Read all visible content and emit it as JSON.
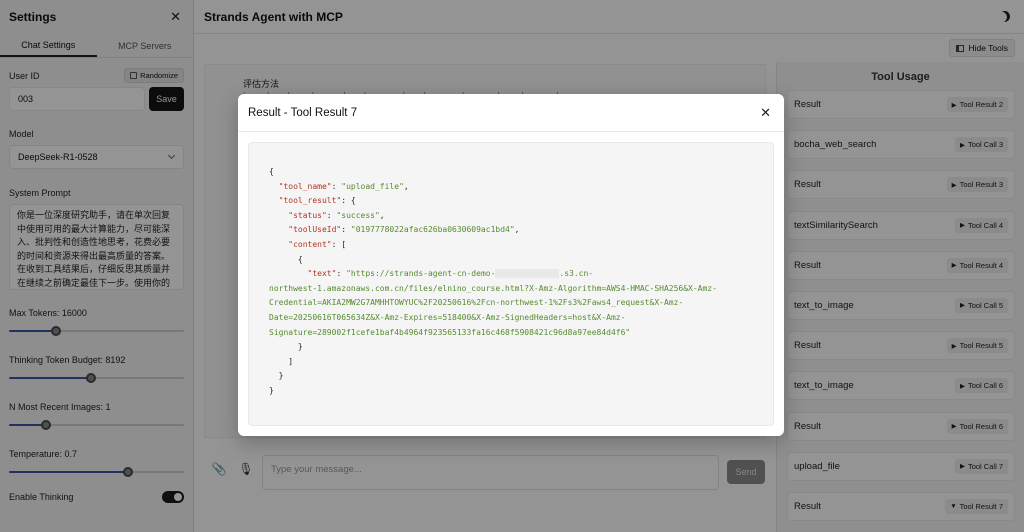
{
  "sidebar": {
    "title": "Settings",
    "close_icon": "close-icon",
    "tabs": [
      {
        "label": "Chat Settings",
        "active": true
      },
      {
        "label": "MCP Servers",
        "active": false
      }
    ],
    "user_id": {
      "label": "User ID",
      "randomize_label": "Randomize",
      "value": "003",
      "save_label": "Save"
    },
    "model": {
      "label": "Model",
      "value": "DeepSeek-R1-0528"
    },
    "system_prompt": {
      "label": "System Prompt",
      "value": "你是一位深度研究助手，请在单次回复中使用可用的最大计算能力，尽可能深入、批判性和创造性地思考，花费必要的时间和资源来得出最高质量的答案。\n在收到工具结果后，仔细反思其质量并在继续之前确定最佳下一步。使用你的思考基于这些新信息进行规划和迭代，然后采"
    },
    "max_tokens": {
      "label": "Max Tokens: 16000",
      "fraction": 0.27
    },
    "thinking_budget": {
      "label": "Thinking Token Budget: 8192",
      "fraction": 0.47
    },
    "n_images": {
      "label": "N Most Recent Images: 1",
      "fraction": 0.21
    },
    "temperature": {
      "label": "Temperature: 0.7",
      "fraction": 0.68
    },
    "enable_thinking": {
      "label": "Enable Thinking",
      "on": true
    }
  },
  "main": {
    "title": "Strands Agent with MCP",
    "theme_icon": "moon-icon",
    "hide_tools_label": "Hide Tools",
    "chat": {
      "heading": "评估方法",
      "partial_line": "| ···· | ··· | ···· | ······ | ··· | ········ | ··· | ········ | ······· | ···· | ······· |"
    },
    "input_placeholder": "Type your message...",
    "send_label": "Send"
  },
  "tool_panel": {
    "title": "Tool Usage",
    "items": [
      {
        "name": "Result",
        "chip": "Tool Result 2",
        "expanded": false
      },
      {
        "name": "bocha_web_search",
        "chip": "Tool Call 3",
        "expanded": false
      },
      {
        "name": "Result",
        "chip": "Tool Result 3",
        "expanded": false
      },
      {
        "name": "textSimilaritySearch",
        "chip": "Tool Call 4",
        "expanded": false
      },
      {
        "name": "Result",
        "chip": "Tool Result 4",
        "expanded": false
      },
      {
        "name": "text_to_image",
        "chip": "Tool Call 5",
        "expanded": false
      },
      {
        "name": "Result",
        "chip": "Tool Result 5",
        "expanded": false
      },
      {
        "name": "text_to_image",
        "chip": "Tool Call 6",
        "expanded": false
      },
      {
        "name": "Result",
        "chip": "Tool Result 6",
        "expanded": false
      },
      {
        "name": "upload_file",
        "chip": "Tool Call 7",
        "expanded": false
      },
      {
        "name": "Result",
        "chip": "Tool Result 7",
        "expanded": true
      }
    ]
  },
  "modal": {
    "title": "Result - Tool Result 7",
    "code": {
      "open": "{",
      "tool_name_key": "\"tool_name\"",
      "tool_name_value": "\"upload_file\"",
      "tool_result_key": "\"tool_result\"",
      "status_key": "\"status\"",
      "status_value": "\"success\"",
      "tool_use_id_key": "\"toolUseId\"",
      "tool_use_id_value": "\"0197778022afac626ba0630609ac1bd4\"",
      "content_key": "\"content\"",
      "text_key": "\"text\"",
      "text_value_start": "\"https://strands-agent-cn-demo-",
      "text_value_line1_end": ".s3.cn-",
      "text_value_line2": "northwest-1.amazonaws.com.cn/files/elnino_course.html?X-Amz-Algorithm=AWS4-HMAC-SHA256&X-Amz-",
      "text_value_line3": "Credential=AKIA2MW2G7AMHHTOWYUC%2F20250616%2Fcn-northwest-1%2Fs3%2Faws4_request&X-Amz-",
      "text_value_line4": "Date=20250616T065634Z&X-Amz-Expires=518400&X-Amz-SignedHeaders=host&X-Amz-",
      "text_value_line5": "Signature=289002f1cefe1baf4b4964f923565133fa16c468f5908421c96d8a97ee84d4f6\""
    }
  }
}
